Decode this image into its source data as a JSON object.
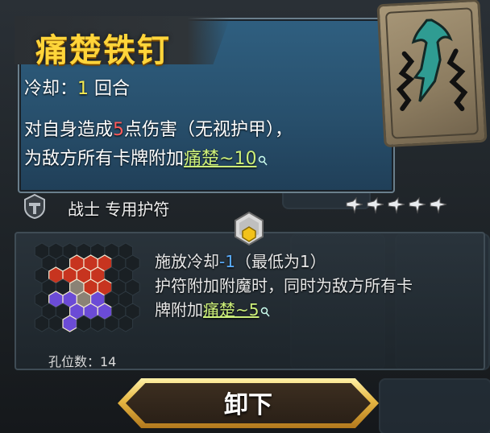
{
  "card": {
    "title": "痛楚铁钉",
    "cooldown_label": "冷却：",
    "cooldown_value": "1",
    "cooldown_unit": " 回合",
    "desc_line1_pre": "对自身造成",
    "desc_line1_num": "5",
    "desc_line1_post": "点伤害（无视护甲），",
    "desc_line2_pre": "为敌方所有卡牌附加",
    "desc_line2_link": "痛楚~10",
    "class_label": "战士 专用护符",
    "star_count": 5
  },
  "socket": {
    "effect_line1_pre": "施放冷却",
    "effect_line1_num": "-1",
    "effect_line1_post": "（最低为1）",
    "effect_line2": "护符附加附魔时，同时为敌方所有卡",
    "effect_line3_pre": "牌附加",
    "effect_line3_link": "痛楚~5",
    "slot_count_label": "孔位数：14"
  },
  "button": {
    "unequip_label": "卸下"
  },
  "colors": {
    "title": "#ffd53a",
    "highlight_red": "#ff5b5b",
    "highlight_blue": "#5aaeff",
    "keyword_green": "#cdf07a",
    "gem_red": "#c7341f",
    "gem_purple": "#6b4bd6",
    "gem_gray": "#8a8275"
  }
}
